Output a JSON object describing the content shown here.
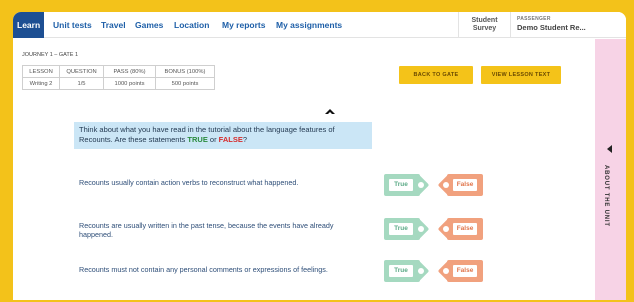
{
  "nav": {
    "tabs": [
      {
        "label": "Learn",
        "active": true
      },
      {
        "label": "Unit tests"
      },
      {
        "label": "Travel"
      },
      {
        "label": "Games"
      },
      {
        "label": "Location"
      },
      {
        "label": "My reports"
      },
      {
        "label": "My assignments"
      }
    ],
    "survey_line1": "Student",
    "survey_line2": "Survey",
    "passenger_label": "PASSENGER",
    "passenger_name": "Demo Student Re..."
  },
  "journey": "JOURNEY 1 – GATE 1",
  "stats": {
    "headers": [
      "LESSON",
      "QUESTION",
      "PASS (80%)",
      "BONUS (100%)"
    ],
    "row": [
      "Writing 2",
      "1/5",
      "1000 points",
      "500 points"
    ]
  },
  "buttons": {
    "back": "BACK TO GATE",
    "view": "VIEW LESSON TEXT"
  },
  "prompt": {
    "text_before": "Think about what you have read in the tutorial about the language features of Recounts. Are these statements ",
    "true_word": "TRUE",
    "or_word": " or ",
    "false_word": "FALSE",
    "end": "?"
  },
  "statements": [
    "Recounts usually contain action verbs to reconstruct what happened.",
    "Recounts are usually written in the past tense, because the events have already happened.",
    "Recounts must not contain any personal comments or expressions of feelings."
  ],
  "options": {
    "true_label": "True",
    "false_label": "False"
  },
  "side_panel": {
    "label": "ABOUT THE UNIT"
  },
  "colors": {
    "background": "#f3c21a",
    "nav_active": "#1d4f93",
    "nav_text": "#1e5fa8",
    "button": "#f4c319",
    "prompt_bg": "#cbe6f6",
    "true_tag": "#a5d9c0",
    "false_tag": "#f1a17e",
    "side_panel": "#f7d3e6"
  }
}
